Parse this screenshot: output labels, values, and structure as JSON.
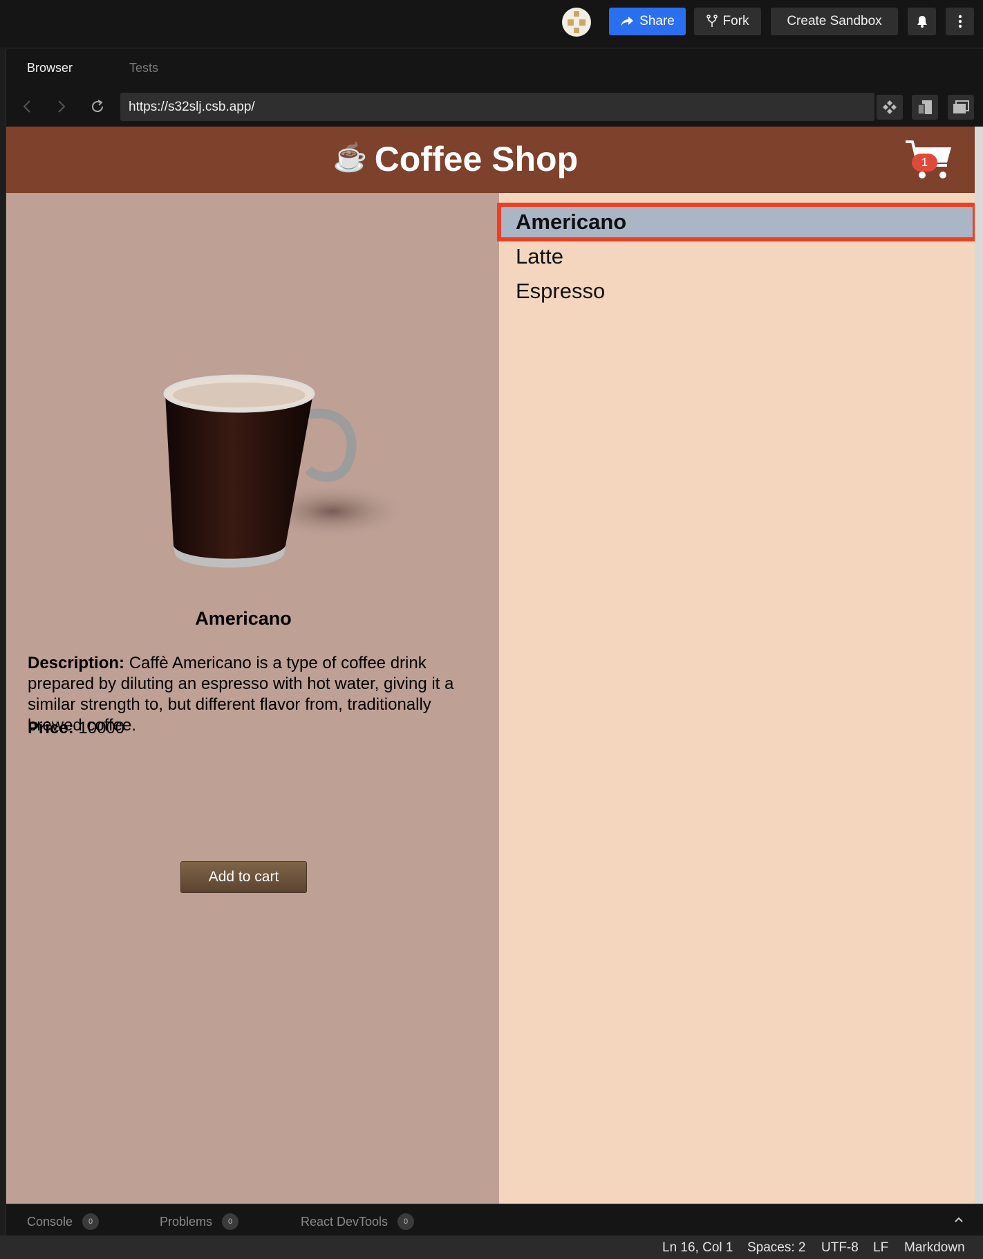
{
  "topbar": {
    "share_label": "Share",
    "fork_label": "Fork",
    "create_label": "Create Sandbox"
  },
  "browser": {
    "tabs": [
      {
        "label": "Browser",
        "active": true
      },
      {
        "label": "Tests",
        "active": false
      }
    ],
    "url": "https://s32slj.csb.app/"
  },
  "app": {
    "title": "Coffee Shop",
    "title_emoji": "☕",
    "cart_count": "1",
    "colors": {
      "header": "#7e412c",
      "left_pane": "#bea095",
      "list_bg": "#f3d6bd",
      "selected_item": "#aab5c6",
      "highlight_outline": "#ec3f24",
      "button": "#6d5440"
    },
    "product": {
      "name": "Americano",
      "description_label": "Description:",
      "description": "Caffè Americano is a type of coffee drink prepared by diluting an espresso with hot water, giving it a similar strength to, but different flavor from, traditionally brewed coffee.",
      "price_label": "Price:",
      "price": "10000",
      "add_label": "Add to cart"
    },
    "menu": [
      "Americano",
      "Latte",
      "Espresso"
    ]
  },
  "devtools": [
    {
      "label": "Console",
      "count": "0"
    },
    {
      "label": "Problems",
      "count": "0"
    },
    {
      "label": "React DevTools",
      "count": "0"
    }
  ],
  "status": {
    "position": "Ln 16, Col 1",
    "spaces": "Spaces: 2",
    "encoding": "UTF-8",
    "eol": "LF",
    "language": "Markdown"
  }
}
